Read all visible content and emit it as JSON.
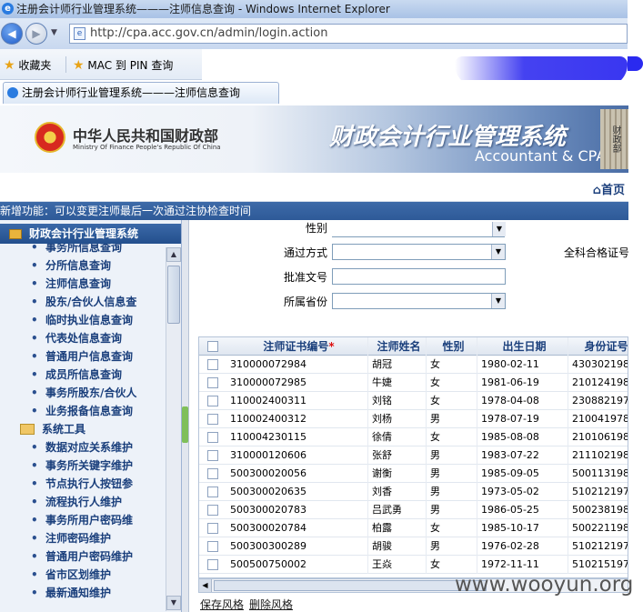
{
  "window": {
    "title": "注册会计师行业管理系统———注师信息查询 - Windows Internet Explorer"
  },
  "browser": {
    "url": "http://cpa.acc.gov.cn/admin/login.action",
    "favorites_label": "收藏夹",
    "fav_link": "MAC 到 PIN 查询",
    "tab_title": "注册会计师行业管理系统———注师信息查询"
  },
  "banner": {
    "ministry_cn": "中华人民共和国财政部",
    "ministry_en": "Ministry Of Finance People's Republic Of China",
    "system_cn": "财政会计行业管理系统",
    "system_en": "Accountant & CPA o",
    "building_text": "财政部"
  },
  "home_label": "首页",
  "notice": "新增功能：可以变更注师最后一次通过注协检查时间",
  "sidebar": {
    "header": "财政会计行业管理系统",
    "items": [
      {
        "label": "事务所信息查询",
        "type": "item"
      },
      {
        "label": "分所信息查询",
        "type": "item"
      },
      {
        "label": "注师信息查询",
        "type": "item"
      },
      {
        "label": "股东/合伙人信息查",
        "type": "item"
      },
      {
        "label": "临时执业信息查询",
        "type": "item"
      },
      {
        "label": "代表处信息查询",
        "type": "item"
      },
      {
        "label": "普通用户信息查询",
        "type": "item"
      },
      {
        "label": "成员所信息查询",
        "type": "item"
      },
      {
        "label": "事务所股东/合伙人",
        "type": "item"
      },
      {
        "label": "业务报备信息查询",
        "type": "item"
      },
      {
        "label": "系统工具",
        "type": "group"
      },
      {
        "label": "数据对应关系维护",
        "type": "item"
      },
      {
        "label": "事务所关键字维护",
        "type": "item"
      },
      {
        "label": "节点执行人按钮参",
        "type": "item"
      },
      {
        "label": "流程执行人维护",
        "type": "item"
      },
      {
        "label": "事务所用户密码维",
        "type": "item"
      },
      {
        "label": "注师密码维护",
        "type": "item"
      },
      {
        "label": "普通用户密码维护",
        "type": "item"
      },
      {
        "label": "省市区划维护",
        "type": "item"
      },
      {
        "label": "最新通知维护",
        "type": "item"
      }
    ]
  },
  "form": {
    "gender_label": "性别",
    "pass_method_label": "通过方式",
    "full_cert_label": "全科合格证号",
    "approval_label": "批准文号",
    "province_label": "所属省份"
  },
  "grid": {
    "columns": [
      "注师证书编号",
      "注师姓名",
      "性别",
      "出生日期",
      "身份证号"
    ],
    "required_mark": "*",
    "rows": [
      [
        "310000072984",
        "胡冠",
        "女",
        "1980-02-11",
        "430302198002"
      ],
      [
        "310000072985",
        "牛婕",
        "女",
        "1981-06-19",
        "210124198106"
      ],
      [
        "110002400311",
        "刘铭",
        "女",
        "1978-04-08",
        "230882197804"
      ],
      [
        "110002400312",
        "刘杨",
        "男",
        "1978-07-19",
        "210041978071"
      ],
      [
        "110004230115",
        "徐倩",
        "女",
        "1985-08-08",
        "210106198508"
      ],
      [
        "310000120606",
        "张舒",
        "男",
        "1983-07-22",
        "211102198307"
      ],
      [
        "500300020056",
        "谢衡",
        "男",
        "1985-09-05",
        "500113198509"
      ],
      [
        "500300020635",
        "刘香",
        "男",
        "1973-05-02",
        "510212197305"
      ],
      [
        "500300020783",
        "吕武勇",
        "男",
        "1986-05-25",
        "500238198605"
      ],
      [
        "500300020784",
        "柏露",
        "女",
        "1985-10-17",
        "500221198510"
      ],
      [
        "500300300289",
        "胡骏",
        "男",
        "1976-02-28",
        "510212197602"
      ],
      [
        "500500750002",
        "王焱",
        "女",
        "1972-11-11",
        "510215197211"
      ]
    ]
  },
  "footer_links": {
    "save": "保存风格",
    "delete": "删除风格"
  },
  "watermark": "www.wooyun.org"
}
